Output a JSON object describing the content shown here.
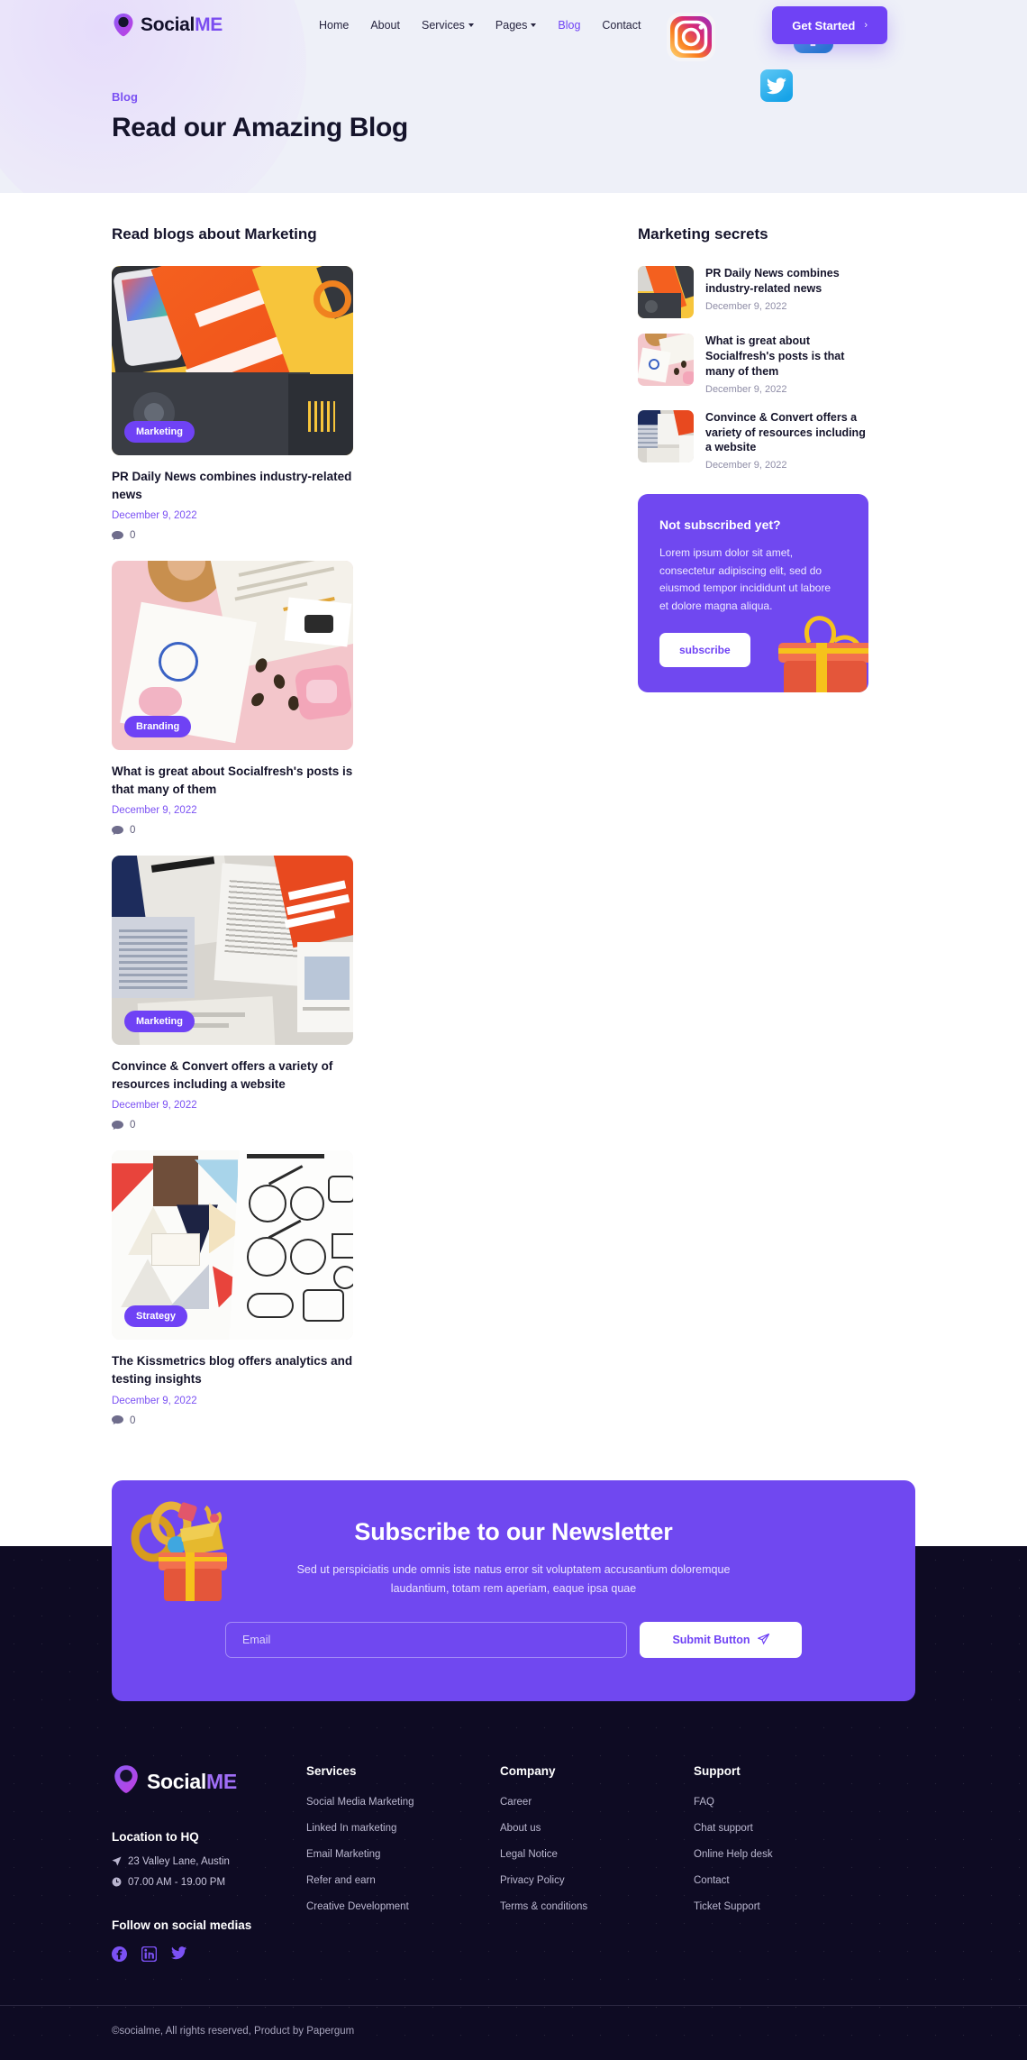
{
  "brand": {
    "name_dark": "Social",
    "name_accent": "ME",
    "logo_icon": "location-pin-logo-icon"
  },
  "nav": {
    "items": [
      {
        "label": "Home",
        "active": false,
        "caret": false
      },
      {
        "label": "About",
        "active": false,
        "caret": false
      },
      {
        "label": "Services",
        "active": false,
        "caret": true
      },
      {
        "label": "Pages",
        "active": false,
        "caret": true
      },
      {
        "label": "Blog",
        "active": true,
        "caret": false
      },
      {
        "label": "Contact",
        "active": false,
        "caret": false
      }
    ],
    "cta_label": "Get Started",
    "cta_chevron": "›"
  },
  "hero": {
    "eyebrow": "Blog",
    "title": "Read our Amazing Blog",
    "floating_icons": [
      "instagram-icon",
      "facebook-icon",
      "twitter-icon"
    ]
  },
  "blog": {
    "section_title": "Read blogs about Marketing",
    "posts": [
      {
        "badge": "Marketing",
        "title": "PR Daily News combines industry-related news",
        "date": "December 9, 2022",
        "comments": "0",
        "thumb": "change-by-design-book-orange-yellow"
      },
      {
        "badge": "Branding",
        "title": "What is great about Socialfresh's posts is that many of them",
        "date": "December 9, 2022",
        "comments": "0",
        "thumb": "donut-brochure-pink-flatlay"
      },
      {
        "badge": "Marketing",
        "title": "Convince & Convert offers a variety of resources including a website",
        "date": "December 9, 2022",
        "comments": "0",
        "thumb": "castro-capital-print-collateral"
      },
      {
        "badge": "Strategy",
        "title": "The Kissmetrics blog offers analytics and testing insights",
        "date": "December 9, 2022",
        "comments": "0",
        "thumb": "hard-way-magazine-line-art"
      }
    ]
  },
  "sidebar": {
    "section_title": "Marketing secrets",
    "items": [
      {
        "title": "PR Daily News combines industry-related news",
        "date": "December 9, 2022",
        "thumb": "change-by-design-book-orange-yellow"
      },
      {
        "title": "What is great about Socialfresh's posts is that many of them",
        "date": "December 9, 2022",
        "thumb": "donut-brochure-pink-flatlay"
      },
      {
        "title": "Convince & Convert offers a variety of resources including a website",
        "date": "December 9, 2022",
        "thumb": "castro-capital-print-collateral"
      }
    ],
    "subscribe_card": {
      "title": "Not subscribed yet?",
      "body": "Lorem ipsum dolor sit amet, consectetur adipiscing elit, sed do eiusmod tempor incididunt ut labore et dolore magna aliqua.",
      "button_label": "subscribe",
      "decoration": "gift-box-icon"
    }
  },
  "newsletter": {
    "title": "Subscribe to our Newsletter",
    "subtitle": "Sed ut perspiciatis unde omnis iste natus error sit voluptatem accusantium doloremque laudantium, totam rem aperiam, eaque ipsa quae",
    "email_placeholder": "Email",
    "email_value": "",
    "submit_label": "Submit Button",
    "submit_icon": "paper-plane-icon",
    "decoration": "gift-confetti-icon"
  },
  "footer": {
    "location_heading": "Location to HQ",
    "address": "23 Valley Lane, Austin",
    "hours": "07.00 AM - 19.00 PM",
    "follow_heading": "Follow on social medias",
    "social": [
      "facebook-icon",
      "linkedin-icon",
      "twitter-icon"
    ],
    "columns": [
      {
        "heading": "Services",
        "links": [
          "Social Media Marketing",
          "Linked In marketing",
          "Email Marketing",
          "Refer and earn",
          "Creative Development"
        ]
      },
      {
        "heading": "Company",
        "links": [
          "Career",
          "About us",
          "Legal Notice",
          "Privacy Policy",
          "Terms & conditions"
        ]
      },
      {
        "heading": "Support",
        "links": [
          "FAQ",
          "Chat support",
          "Online Help desk",
          "Contact",
          "Ticket Support"
        ]
      }
    ],
    "copyright": "©socialme, All rights reserved, Product by Papergum"
  },
  "colors": {
    "accent": "#6f42f5",
    "accent_card": "#7048f0",
    "hero_bg": "#eef0f8",
    "footer_bg": "#0e0b23",
    "text_dark": "#15142b",
    "muted": "#8e8ca6"
  }
}
